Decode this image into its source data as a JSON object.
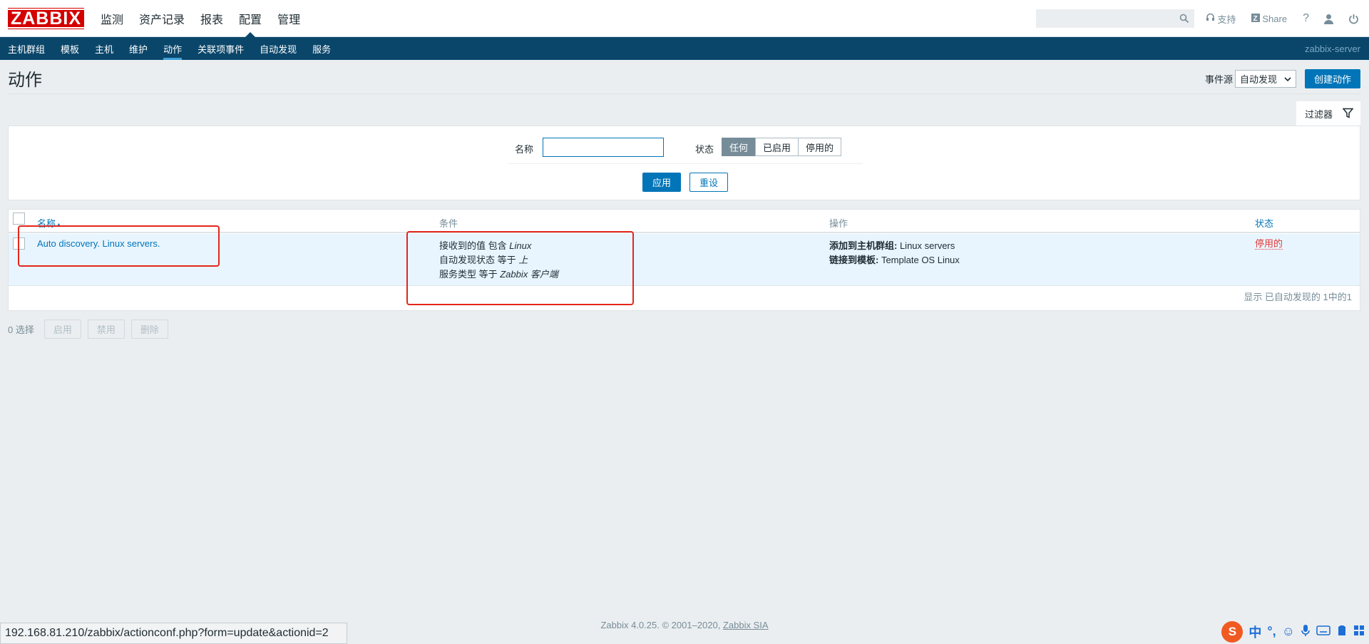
{
  "topbar": {
    "logo": "ZABBIX",
    "menu": [
      "监测",
      "资产记录",
      "报表",
      "配置",
      "管理"
    ],
    "active_menu": "配置",
    "support_label": "支持",
    "share_label": "Share",
    "help_label": "?"
  },
  "submenu": {
    "items": [
      "主机群组",
      "模板",
      "主机",
      "维护",
      "动作",
      "关联项事件",
      "自动发现",
      "服务"
    ],
    "active": "动作",
    "server_name": "zabbix-server"
  },
  "header": {
    "title": "动作",
    "event_source_label": "事件源",
    "event_source_value": "自动发现",
    "create_button": "创建动作"
  },
  "filter": {
    "tab_label": "过滤器",
    "name_label": "名称",
    "name_value": "",
    "status_label": "状态",
    "status_options": [
      "任何",
      "已启用",
      "停用的"
    ],
    "status_selected": "任何",
    "apply_label": "应用",
    "reset_label": "重设"
  },
  "table": {
    "columns": {
      "name": "名称",
      "conditions": "条件",
      "operations": "操作",
      "status": "状态"
    },
    "sort_indicator": "▲",
    "rows": [
      {
        "name": "Auto discovery. Linux servers.",
        "conditions": [
          {
            "text": "接收到的值 包含 ",
            "value": "Linux"
          },
          {
            "text": "自动发现状态 等于 ",
            "value": "上"
          },
          {
            "text": "服务类型 等于 ",
            "value": "Zabbix 客户端"
          }
        ],
        "operations": [
          {
            "label": "添加到主机群组:",
            "value": " Linux servers"
          },
          {
            "label": "链接到模板:",
            "value": " Template OS Linux"
          }
        ],
        "status": "停用的"
      }
    ],
    "footer": "显示 已自动发现的 1中的1"
  },
  "actions": {
    "selected_count": "0 选择",
    "enable": "启用",
    "disable": "禁用",
    "delete": "删除"
  },
  "footer": {
    "text": "Zabbix 4.0.25. © 2001–2020,",
    "link": "Zabbix SIA"
  },
  "browser_status": "192.168.81.210/zabbix/actionconf.php?form=update&actionid=2",
  "ime": {
    "logo": "S",
    "mode": "中"
  },
  "colors": {
    "brand_red": "#d40000",
    "nav_blue": "#0a466a",
    "accent_blue": "#0275b8",
    "highlight_red": "#e3261c",
    "status_disabled": "#e33734"
  }
}
